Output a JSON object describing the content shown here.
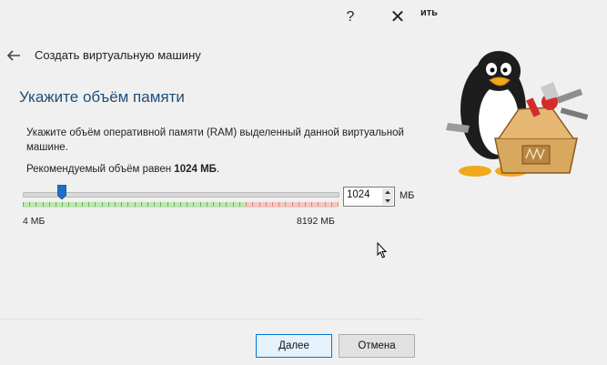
{
  "window": {
    "help_glyph": "?",
    "close_glyph": "✕",
    "background_text": "ить"
  },
  "wizard": {
    "title": "Создать виртуальную машину",
    "heading": "Укажите объём памяти",
    "description": "Укажите объём оперативной памяти (RAM) выделенный данной виртуальной машине.",
    "recommendation_prefix": "Рекомендуемый объём равен ",
    "recommendation_value": "1024 МБ",
    "recommendation_suffix": "."
  },
  "memory": {
    "min_label": "4 МБ",
    "max_label": "8192 МБ",
    "value": "1024",
    "unit": "МБ",
    "min": 4,
    "max": 8192,
    "current": 1024,
    "green_until": 5800
  },
  "buttons": {
    "next": "Далее",
    "cancel": "Отмена"
  },
  "colors": {
    "heading": "#1f4e79",
    "thumb": "#1e6fc6",
    "default_button_border": "#0078d7"
  },
  "icons": {
    "back": "arrow-left-icon",
    "mascot": "penguin-toolbox-illustration",
    "cursor": "mouse-pointer-icon"
  }
}
